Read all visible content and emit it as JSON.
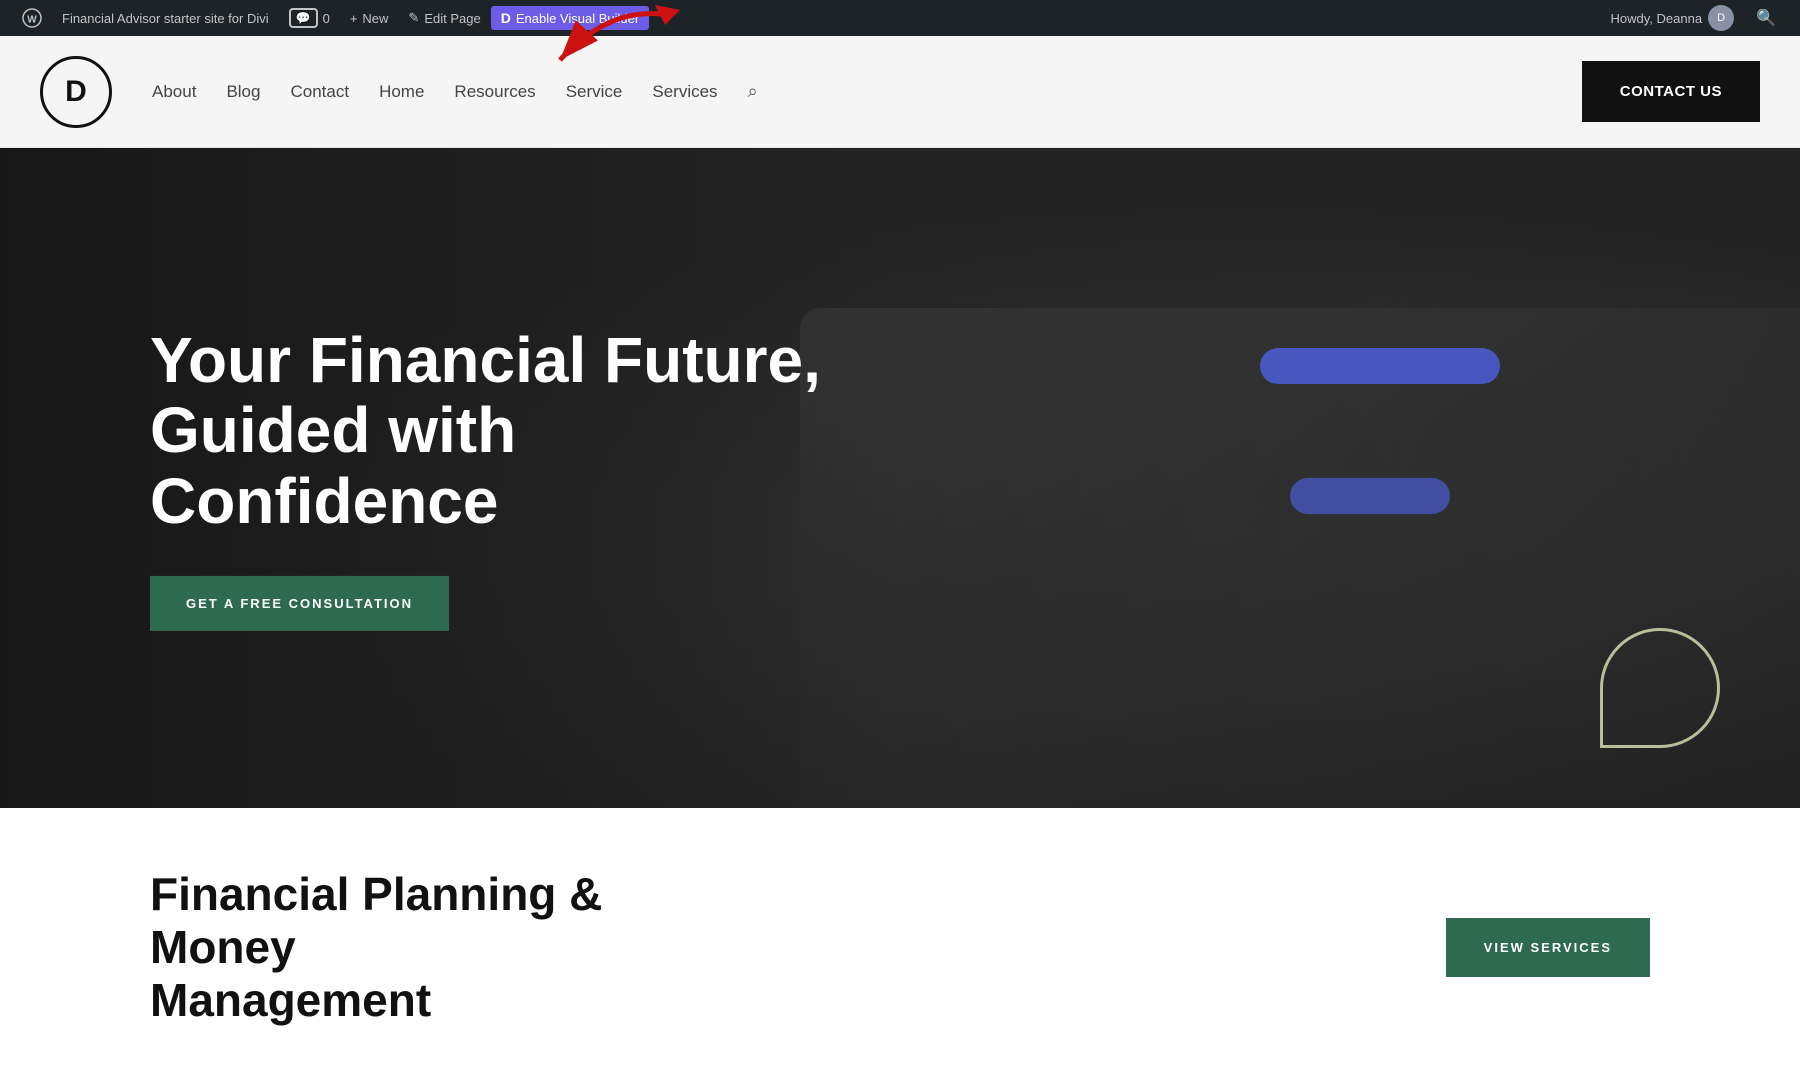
{
  "admin_bar": {
    "site_name": "Financial Advisor starter site for Divi",
    "comments_label": "0",
    "new_label": "New",
    "edit_page_label": "Edit Page",
    "enable_vb_label": "Enable Visual Builder",
    "howdy_label": "Howdy, Deanna",
    "wp_logo": "⊕",
    "divi_letter": "D"
  },
  "header": {
    "logo_letter": "D",
    "nav": {
      "about": "About",
      "blog": "Blog",
      "contact": "Contact",
      "home": "Home",
      "resources": "Resources",
      "service": "Service",
      "services": "Services"
    },
    "contact_btn": "CONTACT US"
  },
  "hero": {
    "heading_line1": "Your Financial Future, Guided with",
    "heading_line2": "Confidence",
    "cta_button": "GET A FREE CONSULTATION"
  },
  "below_fold": {
    "heading_line1": "Financial Planning & Money",
    "heading_line2": "Management",
    "view_services_btn": "VIEW SERVICES"
  }
}
